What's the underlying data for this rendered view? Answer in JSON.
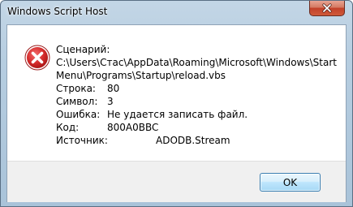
{
  "window": {
    "title": "Windows Script Host"
  },
  "message": {
    "script_label": "Сценарий:",
    "script_path_line1": "C:\\Users\\Стас\\AppData\\Roaming\\Microsoft\\Windows\\Start",
    "script_path_line2": "Menu\\Programs\\Startup\\reload.vbs",
    "fields": [
      {
        "label": "Строка:",
        "value": "80"
      },
      {
        "label": "Символ:",
        "value": "3"
      },
      {
        "label": "Ошибка:",
        "value": "Не удается записать файл."
      },
      {
        "label": "Код:",
        "value": "800A0BBC"
      },
      {
        "label": "Источник:",
        "value": "ADODB.Stream"
      }
    ]
  },
  "buttons": {
    "ok_label": "OK"
  },
  "icons": {
    "error": "error-icon",
    "close": "close-icon"
  },
  "colors": {
    "error_red": "#d32a2a",
    "close_button": "#c24129",
    "ok_border": "#3c7fb1"
  }
}
